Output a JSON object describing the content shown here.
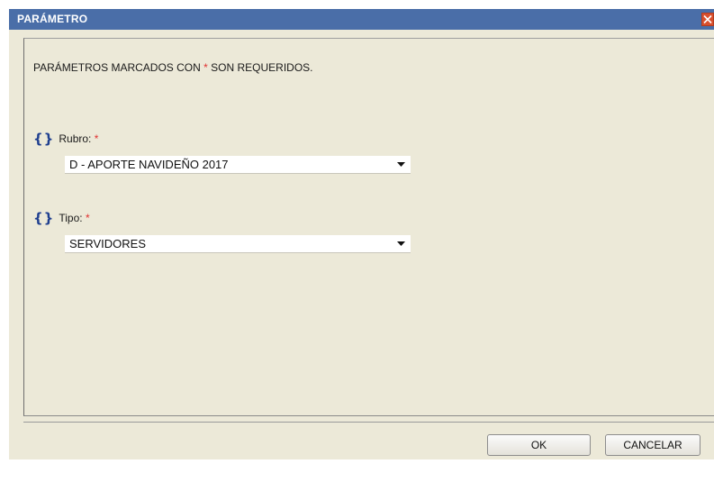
{
  "dialog": {
    "title": "PARÁMETRO",
    "notice": {
      "prefix": "PARÁMETROS MARCADOS CON ",
      "required_mark": "*",
      "suffix": " SON REQUERIDOS."
    },
    "fields": [
      {
        "label": "Rubro:",
        "required_mark": "*",
        "icon": "braces-icon",
        "selected_value": "D - APORTE NAVIDEÑO 2017"
      },
      {
        "label": "Tipo:",
        "required_mark": "*",
        "icon": "braces-icon",
        "selected_value": "SERVIDORES"
      }
    ],
    "buttons": {
      "ok": "OK",
      "cancel": "CANCELAR"
    }
  },
  "colors": {
    "title_bar": "#4a6ea8",
    "dialog_background": "#ece9d8",
    "required_mark": "#e03030",
    "close_button": "#d9502e",
    "brace_icon": "#1f3f8f"
  }
}
